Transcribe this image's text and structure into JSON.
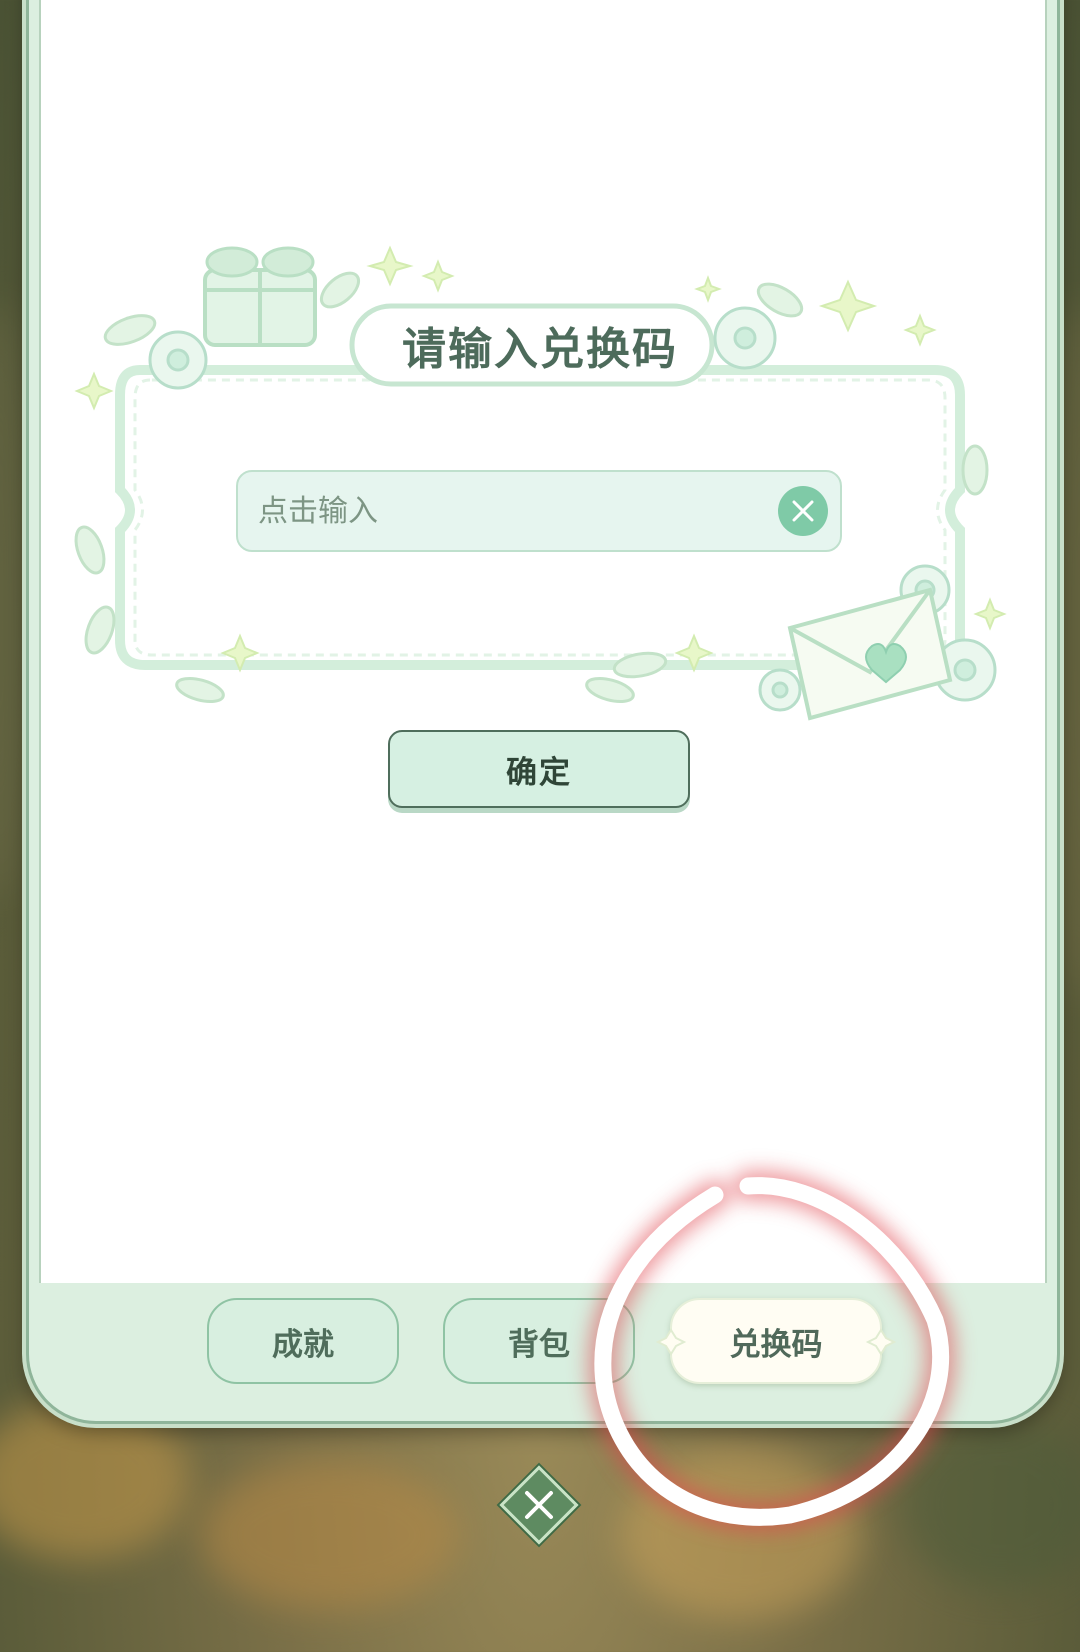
{
  "dialog": {
    "title": "请输入兑换码",
    "input_placeholder": "点击输入",
    "input_value": "",
    "confirm_label": "确定"
  },
  "tabs": [
    {
      "label": "成就",
      "active": false
    },
    {
      "label": "背包",
      "active": false
    },
    {
      "label": "兑换码",
      "active": true
    }
  ],
  "icons": {
    "clear": "close-icon",
    "close_dialog": "close-icon"
  },
  "colors": {
    "accent_green": "#7fcaa7",
    "text_green": "#4d6b5b",
    "panel_bg": "#dcefe0",
    "annotation_circle": "#ffffff",
    "annotation_glow": "#e0474f"
  }
}
